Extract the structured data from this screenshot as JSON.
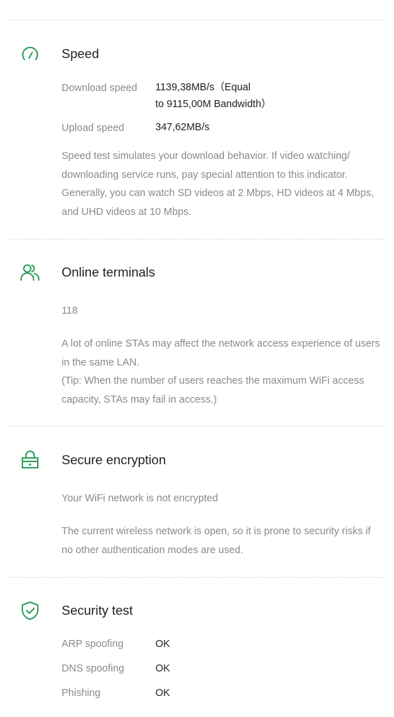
{
  "colors": {
    "accent": "#2e9d5c",
    "title_text": "#1f1f1f",
    "secondary_text": "#8a8a8a",
    "divider": "#dcdcdc"
  },
  "speed": {
    "icon": "speedometer-icon",
    "title": "Speed",
    "download_label": "Download speed",
    "download_value_line1": "1139,38MB/s（Equal",
    "download_value_line2": "to 9115,00M Bandwidth）",
    "upload_label": "Upload speed",
    "upload_value": "347,62MB/s",
    "description": "Speed test simulates your download behavior. If video watching/ downloading service runs, pay special attention to this indicator. Generally, you can watch SD videos at 2 Mbps, HD videos at 4 Mbps, and UHD videos at 10 Mbps."
  },
  "online_terminals": {
    "icon": "users-icon",
    "title": "Online terminals",
    "count": "118",
    "description_line1": "A lot of online STAs may affect the network access experience of users in the same LAN.",
    "description_line2": "(Tip: When the number of users reaches the maximum WiFi access capacity, STAs may fail in access.)"
  },
  "secure_encryption": {
    "icon": "lock-icon",
    "title": "Secure encryption",
    "status": "Your WiFi network is not encrypted",
    "description": "The current wireless network is open, so it is prone to security risks if no other authentication modes are used."
  },
  "security_test": {
    "icon": "shield-check-icon",
    "title": "Security test",
    "items": [
      {
        "label": "ARP spoofing",
        "value": "OK"
      },
      {
        "label": "DNS spoofing",
        "value": "OK"
      },
      {
        "label": "Phishing",
        "value": "OK"
      }
    ]
  }
}
